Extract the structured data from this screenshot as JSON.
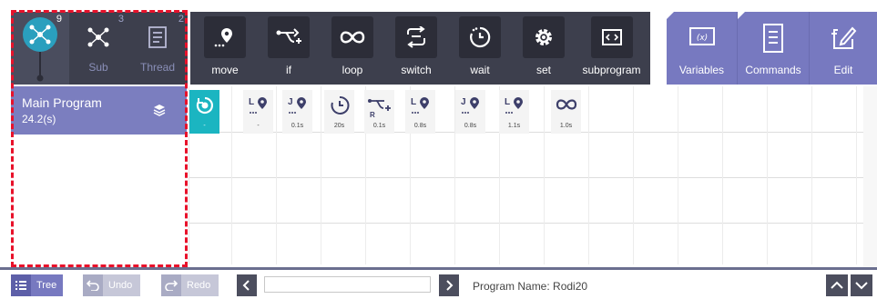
{
  "mode_tabs": [
    {
      "label": "",
      "count": "9"
    },
    {
      "label": "Sub",
      "count": "3"
    },
    {
      "label": "Thread",
      "count": "2"
    }
  ],
  "commands": [
    {
      "label": "move",
      "icon": "move-icon"
    },
    {
      "label": "if",
      "icon": "if-icon"
    },
    {
      "label": "loop",
      "icon": "loop-icon"
    },
    {
      "label": "switch",
      "icon": "switch-icon"
    },
    {
      "label": "wait",
      "icon": "wait-icon"
    },
    {
      "label": "set",
      "icon": "set-icon"
    },
    {
      "label": "subprogram",
      "icon": "subprogram-icon"
    }
  ],
  "right_tools": [
    {
      "label": "Variables",
      "icon": "variables-icon"
    },
    {
      "label": "Commands",
      "icon": "commands-icon"
    },
    {
      "label": "Edit",
      "icon": "edit-icon"
    }
  ],
  "program": {
    "name": "Main Program",
    "time": "24.2(s)"
  },
  "steps": [
    {
      "icon": "start-icon",
      "value": "-",
      "prefix": ""
    },
    {
      "icon": "linear-move-icon",
      "value": "-",
      "prefix": "L"
    },
    {
      "icon": "joint-move-icon",
      "value": "0.1s",
      "prefix": "J"
    },
    {
      "icon": "wait-icon",
      "value": "20s",
      "prefix": ""
    },
    {
      "icon": "if-icon",
      "value": "0.1s",
      "prefix": "R"
    },
    {
      "icon": "linear-move-icon",
      "value": "0.8s",
      "prefix": "L"
    },
    {
      "icon": "joint-move-icon",
      "value": "0.8s",
      "prefix": "J"
    },
    {
      "icon": "linear-move-icon",
      "value": "1.1s",
      "prefix": "L"
    },
    {
      "icon": "loop-icon",
      "value": "1.0s",
      "prefix": ""
    }
  ],
  "bottom": {
    "tree_label": "Tree",
    "undo_label": "Undo",
    "redo_label": "Redo",
    "program_name_label": "Program Name: Rodi20",
    "program_input_value": ""
  },
  "colors": {
    "toolbar_dark": "#3d3f4d",
    "accent_purple": "#7779c0",
    "active_step": "#1bb5c1",
    "highlight_dash": "#e8112a"
  }
}
